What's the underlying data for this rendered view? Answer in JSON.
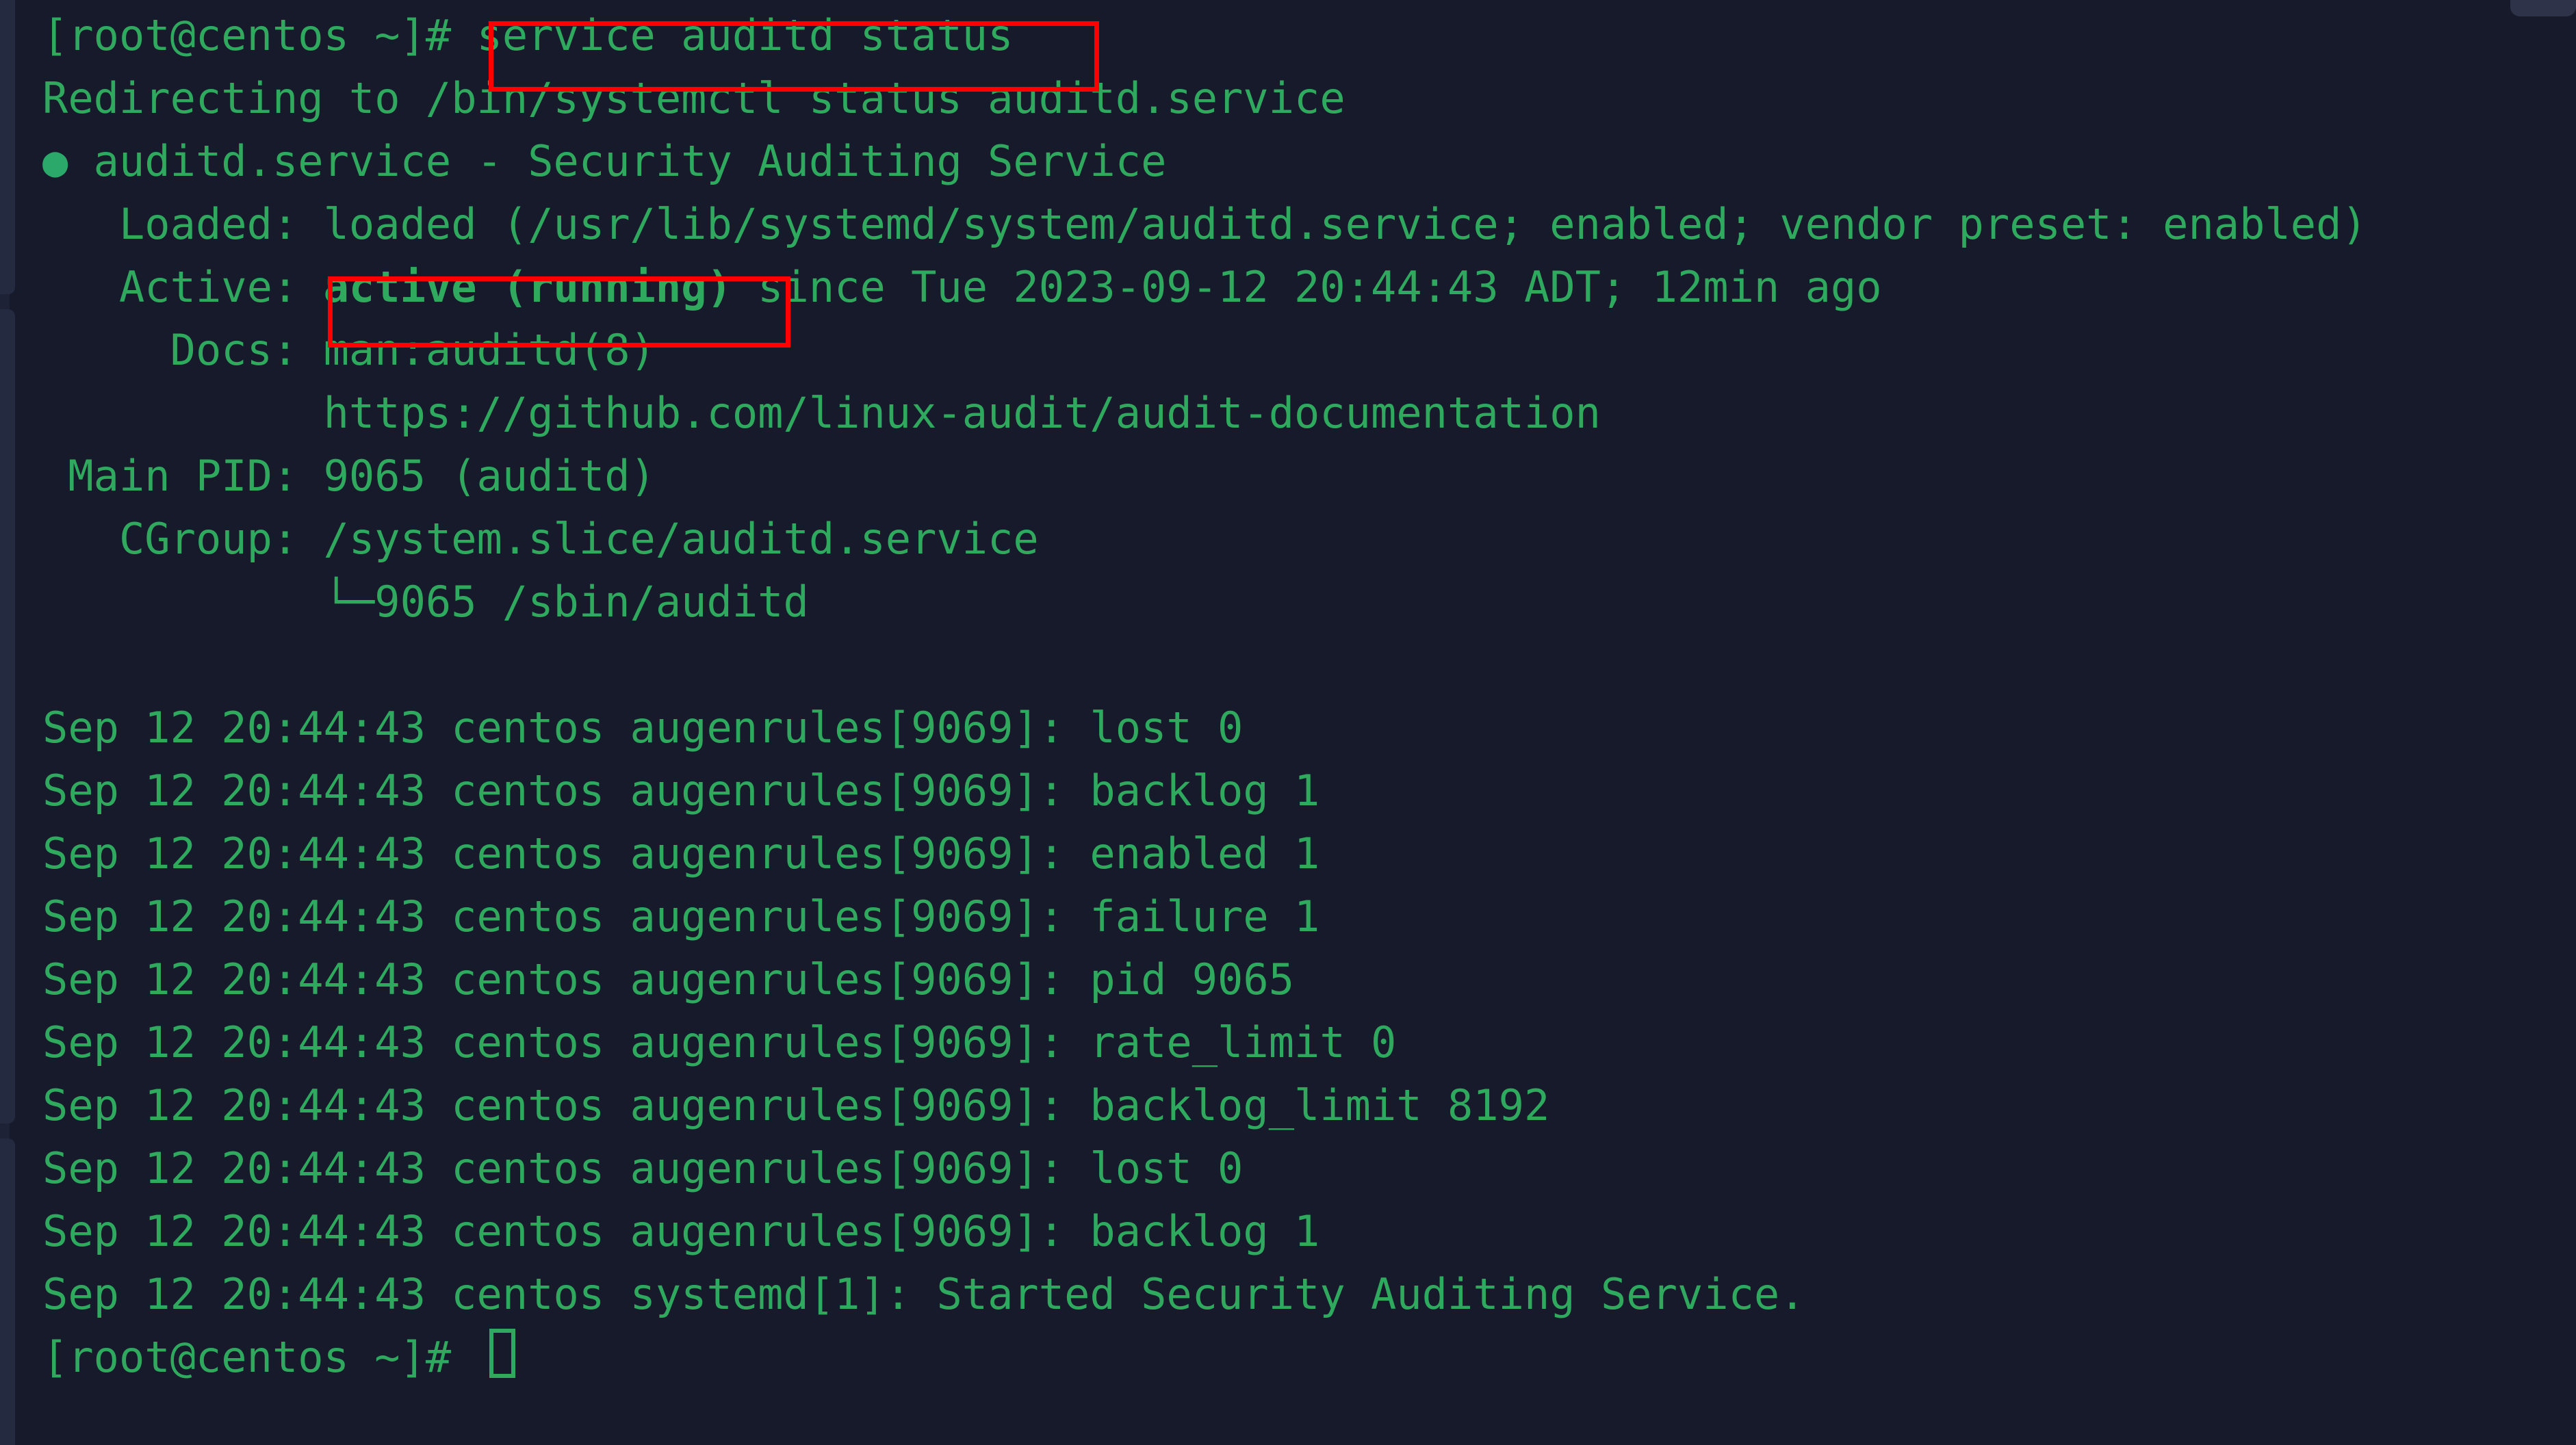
{
  "terminal": {
    "background_color": "#161a2b",
    "text_color": "#2fa95e",
    "highlight_color": "#fe0000",
    "prompt": "[root@centos ~]# ",
    "command": "service auditd status",
    "cursor_glyph": "block-outline"
  },
  "lines": {
    "l01_prompt": "[root@centos ~]# ",
    "l01_command": "service auditd status",
    "l02": "Redirecting to /bin/systemctl status auditd.service",
    "l03_bullet": "●",
    "l03_text": " auditd.service - Security Auditing Service",
    "l04": "   Loaded: loaded (/usr/lib/systemd/system/auditd.service; enabled; vendor preset: enabled)",
    "l05_label": "   Active: ",
    "l05_status": "active (running)",
    "l05_rest": " since Tue 2023-09-12 20:44:43 ADT; 12min ago",
    "l06": "     Docs: man:auditd(8)",
    "l07": "           https://github.com/linux-audit/audit-documentation",
    "l08": " Main PID: 9065 (auditd)",
    "l09": "   CGroup: /system.slice/auditd.service",
    "l10": "           └─9065 /sbin/auditd",
    "l11": "",
    "l12": "Sep 12 20:44:43 centos augenrules[9069]: lost 0",
    "l13": "Sep 12 20:44:43 centos augenrules[9069]: backlog 1",
    "l14": "Sep 12 20:44:43 centos augenrules[9069]: enabled 1",
    "l15": "Sep 12 20:44:43 centos augenrules[9069]: failure 1",
    "l16": "Sep 12 20:44:43 centos augenrules[9069]: pid 9065",
    "l17": "Sep 12 20:44:43 centos augenrules[9069]: rate_limit 0",
    "l18": "Sep 12 20:44:43 centos augenrules[9069]: backlog_limit 8192",
    "l19": "Sep 12 20:44:43 centos augenrules[9069]: lost 0",
    "l20": "Sep 12 20:44:43 centos augenrules[9069]: backlog 1",
    "l21": "Sep 12 20:44:43 centos systemd[1]: Started Security Auditing Service.",
    "l22": "[root@centos ~]# "
  },
  "service_status": {
    "unit": "auditd.service",
    "description": "Security Auditing Service",
    "loaded": "loaded",
    "unit_file": "/usr/lib/systemd/system/auditd.service",
    "enabled_state": "enabled",
    "vendor_preset": "enabled",
    "active_state": "active (running)",
    "since": "Tue 2023-09-12 20:44:43 ADT",
    "uptime": "12min ago",
    "docs_man": "man:auditd(8)",
    "docs_url": "https://github.com/linux-audit/audit-documentation",
    "main_pid": "9065",
    "main_pid_name": "auditd",
    "cgroup": "/system.slice/auditd.service",
    "cgroup_child": "9065 /sbin/auditd"
  },
  "journal": {
    "host": "centos",
    "timestamp": "Sep 12 20:44:43",
    "entries": [
      {
        "process": "augenrules[9069]",
        "message": "lost 0"
      },
      {
        "process": "augenrules[9069]",
        "message": "backlog 1"
      },
      {
        "process": "augenrules[9069]",
        "message": "enabled 1"
      },
      {
        "process": "augenrules[9069]",
        "message": "failure 1"
      },
      {
        "process": "augenrules[9069]",
        "message": "pid 9065"
      },
      {
        "process": "augenrules[9069]",
        "message": "rate_limit 0"
      },
      {
        "process": "augenrules[9069]",
        "message": "backlog_limit 8192"
      },
      {
        "process": "augenrules[9069]",
        "message": "lost 0"
      },
      {
        "process": "augenrules[9069]",
        "message": "backlog 1"
      },
      {
        "process": "systemd[1]",
        "message": "Started Security Auditing Service."
      }
    ]
  },
  "annotations": {
    "box_command_label": "service auditd status",
    "box_status_label": "active (running)"
  }
}
